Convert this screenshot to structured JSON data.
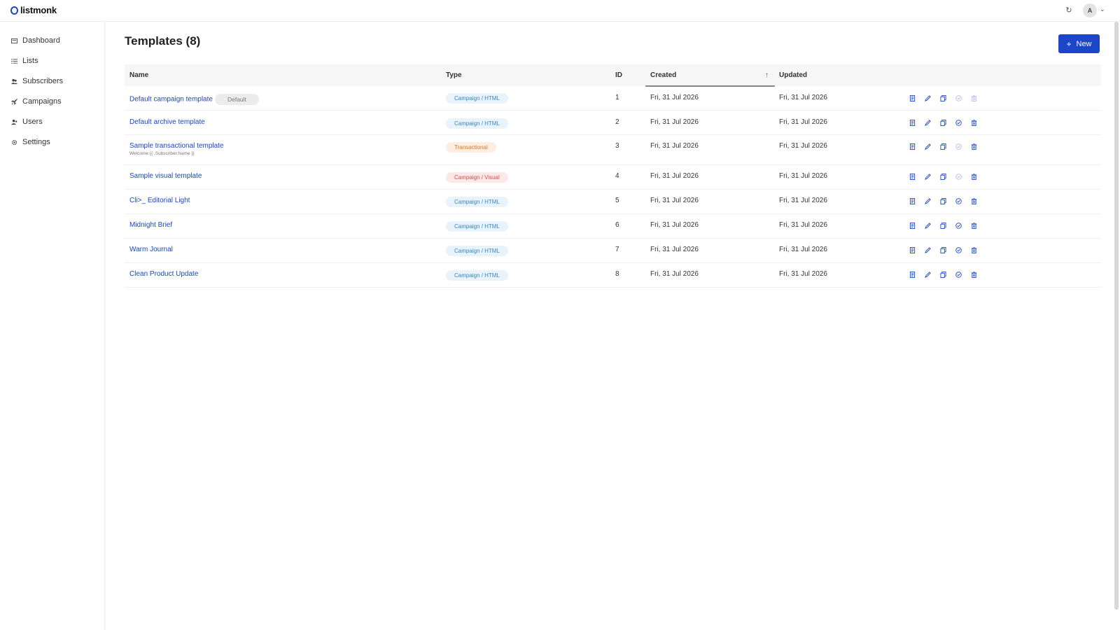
{
  "app": {
    "name": "listmonk"
  },
  "header": {
    "avatar_initial": "A"
  },
  "sidebar": {
    "items": [
      {
        "label": "Dashboard",
        "icon": "dashboard-icon"
      },
      {
        "label": "Lists",
        "icon": "list-icon"
      },
      {
        "label": "Subscribers",
        "icon": "users-icon"
      },
      {
        "label": "Campaigns",
        "icon": "rocket-icon"
      },
      {
        "label": "Users",
        "icon": "user-icon"
      },
      {
        "label": "Settings",
        "icon": "gear-icon"
      }
    ]
  },
  "page": {
    "title": "Templates (8)",
    "new_button": "New"
  },
  "table": {
    "columns": [
      "Name",
      "Type",
      "ID",
      "Created",
      "Updated"
    ],
    "rows": [
      {
        "name": "Default campaign template",
        "badge": "Default",
        "subtext": "",
        "type": "Campaign / HTML",
        "id": "1",
        "created": "Fri, 31 Jul 2026",
        "updated": "Fri, 31 Jul 2026"
      },
      {
        "name": "Default archive template",
        "badge": "",
        "subtext": "",
        "type": "Campaign / HTML",
        "id": "2",
        "created": "Fri, 31 Jul 2026",
        "updated": "Fri, 31 Jul 2026"
      },
      {
        "name": "Sample transactional template",
        "badge": "",
        "subtext": "Welcome {{ .Subscriber.Name }}",
        "type": "Transactional",
        "id": "3",
        "created": "Fri, 31 Jul 2026",
        "updated": "Fri, 31 Jul 2026"
      },
      {
        "name": "Sample visual template",
        "badge": "",
        "subtext": "",
        "type": "Campaign / Visual",
        "id": "4",
        "created": "Fri, 31 Jul 2026",
        "updated": "Fri, 31 Jul 2026"
      },
      {
        "name": "Cli>_ Editorial Light",
        "badge": "",
        "subtext": "",
        "type": "Campaign / HTML",
        "id": "5",
        "created": "Fri, 31 Jul 2026",
        "updated": "Fri, 31 Jul 2026"
      },
      {
        "name": "Midnight Brief",
        "badge": "",
        "subtext": "",
        "type": "Campaign / HTML",
        "id": "6",
        "created": "Fri, 31 Jul 2026",
        "updated": "Fri, 31 Jul 2026"
      },
      {
        "name": "Warm Journal",
        "badge": "",
        "subtext": "",
        "type": "Campaign / HTML",
        "id": "7",
        "created": "Fri, 31 Jul 2026",
        "updated": "Fri, 31 Jul 2026"
      },
      {
        "name": "Clean Product Update",
        "badge": "",
        "subtext": "",
        "type": "Campaign / HTML",
        "id": "8",
        "created": "Fri, 31 Jul 2026",
        "updated": "Fri, 31 Jul 2026"
      }
    ]
  },
  "colors": {
    "accent": "#1a46c7",
    "tag_html_bg": "#e8f3fb",
    "tag_transactional_bg": "#fdeee1",
    "tag_visual_bg": "#fde8e8"
  }
}
